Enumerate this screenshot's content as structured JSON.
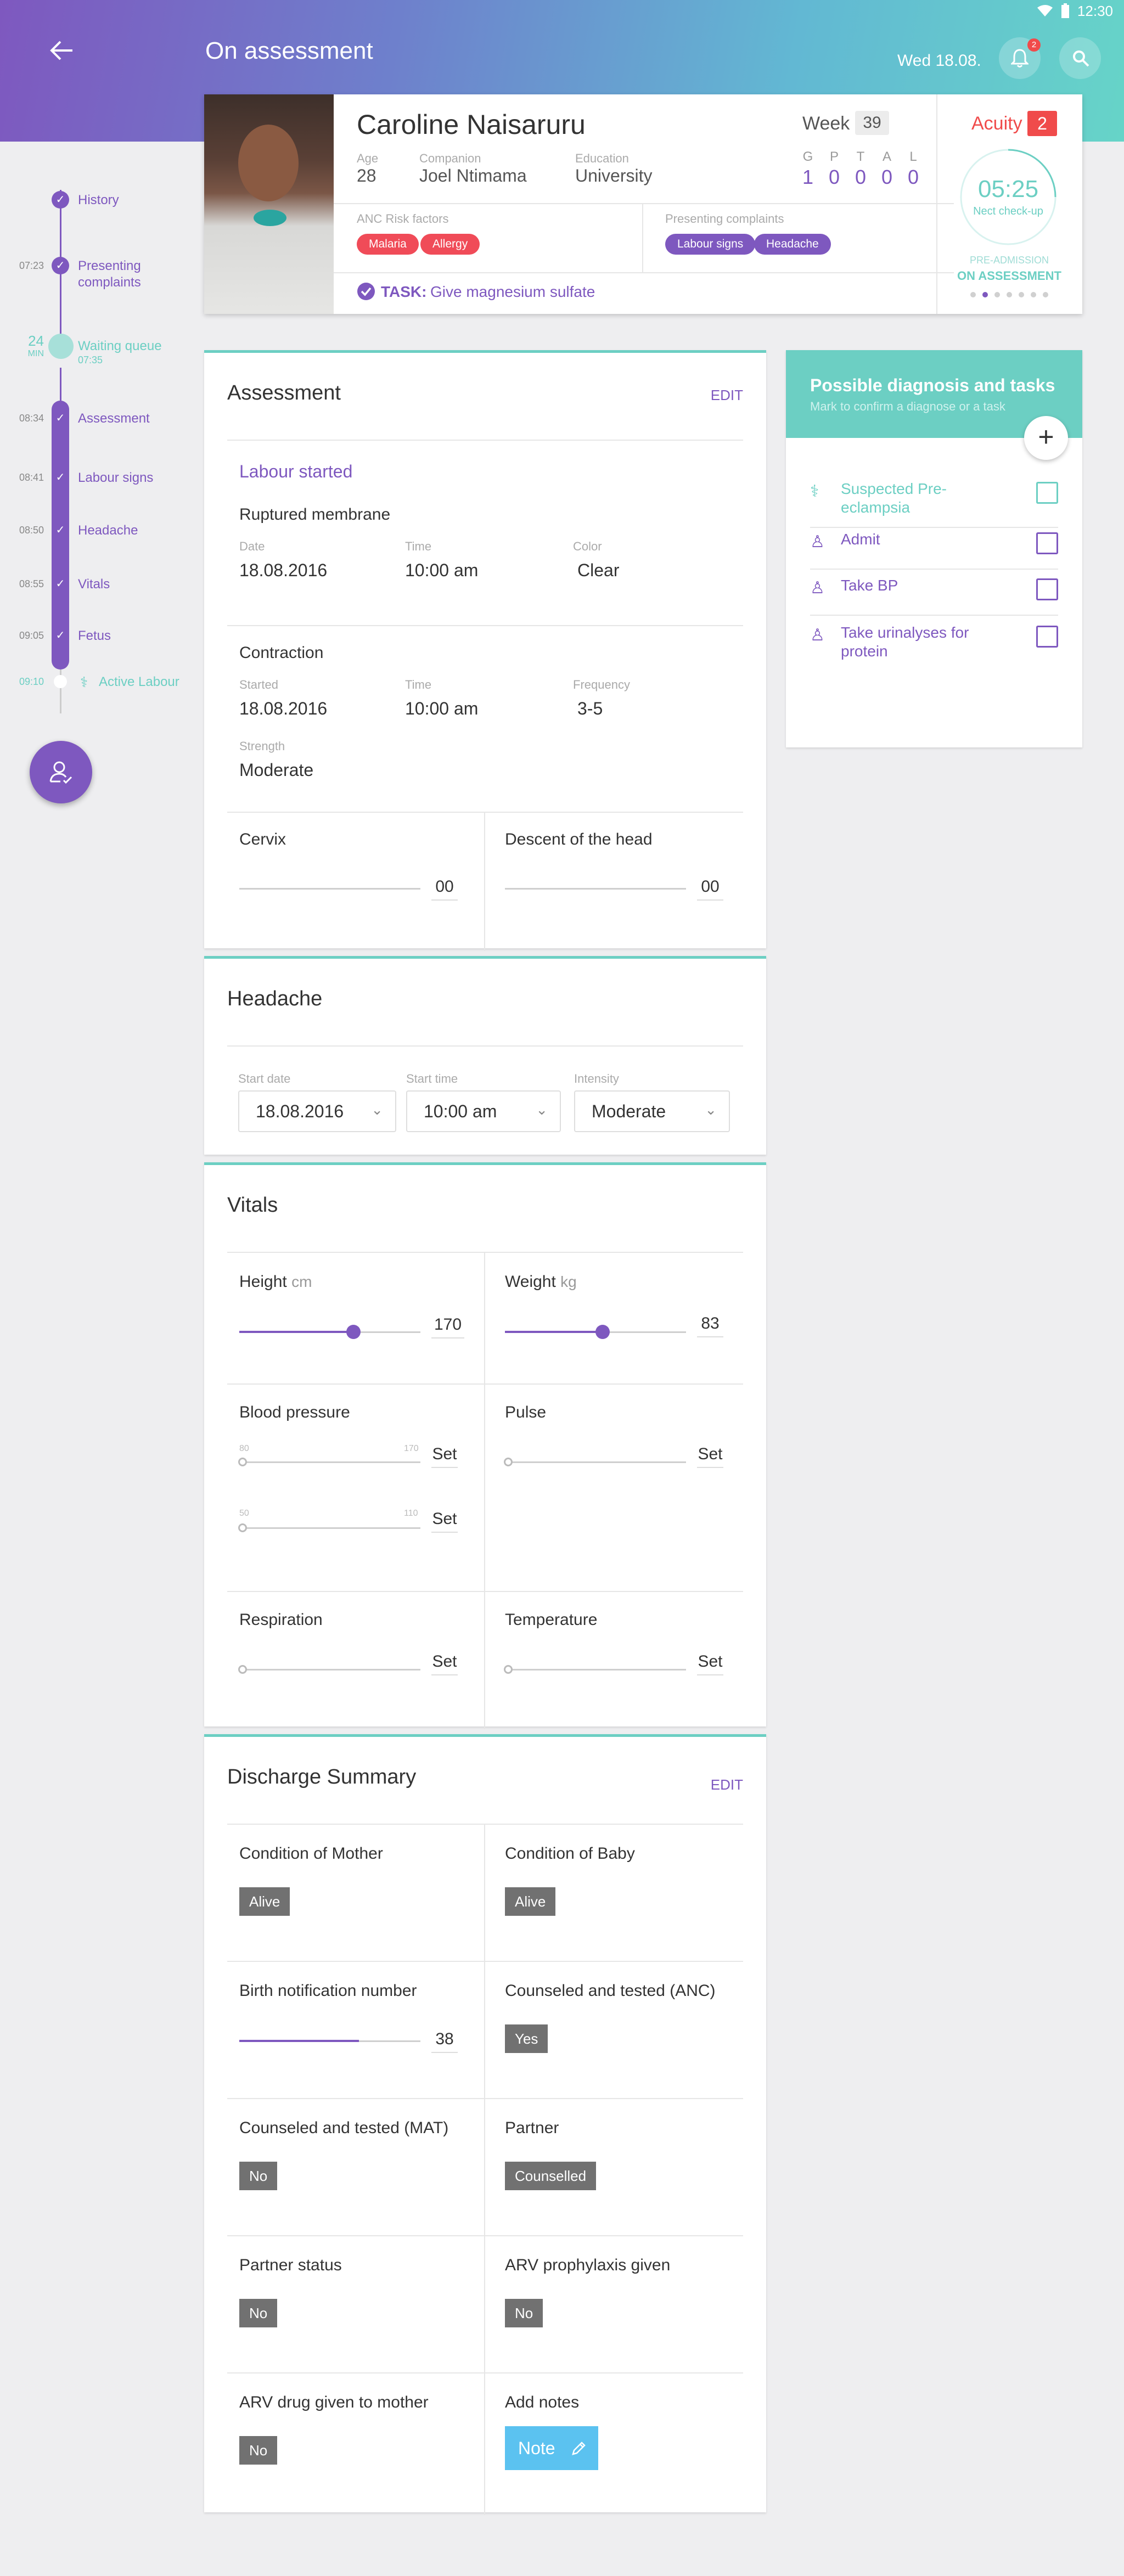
{
  "status_bar": {
    "time": "12:30"
  },
  "header": {
    "title": "On assessment",
    "date": "Wed 18.08.",
    "notification_count": "2"
  },
  "patient": {
    "name": "Caroline Naisaruru",
    "age_label": "Age",
    "age": "28",
    "companion_label": "Companion",
    "companion": "Joel Ntimama",
    "education_label": "Education",
    "education": "University",
    "week_label": "Week",
    "week": "39",
    "gptal_letters": [
      "G",
      "P",
      "T",
      "A",
      "L"
    ],
    "gptal_values": [
      "1",
      "0",
      "0",
      "0",
      "0"
    ],
    "risk_label": "ANC Risk factors",
    "risk_factors": [
      "Malaria",
      "Allergy"
    ],
    "complaints_label": "Presenting complaints",
    "complaints": [
      "Labour signs",
      "Headache"
    ],
    "task_label": "TASK:",
    "task_text": "Give magnesium sulfate"
  },
  "acuity": {
    "label": "Acuity",
    "value": "2",
    "timer": "05:25",
    "timer_sub": "Nect check-up",
    "pre_admission": "PRE-ADMISSION",
    "on_assessment": "ON ASSESSMENT",
    "dots_active": 1,
    "dots_total": 7
  },
  "timeline": [
    {
      "label": "History",
      "time": ""
    },
    {
      "label": "Presenting complaints",
      "time": "07:23"
    },
    {
      "label": "Waiting queue",
      "time": "24",
      "unit": "MIN",
      "sub": "07:35"
    },
    {
      "label": "Assessment",
      "time": "08:34"
    },
    {
      "label": "Labour signs",
      "time": "08:41"
    },
    {
      "label": "Headache",
      "time": "08:50"
    },
    {
      "label": "Vitals",
      "time": "08:55"
    },
    {
      "label": "Fetus",
      "time": "09:05"
    },
    {
      "label": "Active Labour",
      "time": "09:10"
    }
  ],
  "assessment": {
    "title": "Assessment",
    "edit": "EDIT",
    "labour_started": "Labour started",
    "ruptured_title": "Ruptured membrane",
    "ruptured": [
      {
        "label": "Date",
        "value": "18.08.2016"
      },
      {
        "label": "Time",
        "value": "10:00 am"
      },
      {
        "label": "Color",
        "value": "Clear"
      }
    ],
    "contraction_title": "Contraction",
    "contraction": [
      {
        "label": "Started",
        "value": "18.08.2016"
      },
      {
        "label": "Time",
        "value": "10:00 am"
      },
      {
        "label": "Frequency",
        "value": "3-5"
      }
    ],
    "strength_label": "Strength",
    "strength": "Moderate",
    "cervix_title": "Cervix",
    "cervix_value": "00",
    "descent_title": "Descent of the head",
    "descent_value": "00"
  },
  "headache": {
    "title": "Headache",
    "start_date_label": "Start date",
    "start_date": "18.08.2016",
    "start_time_label": "Start time",
    "start_time": "10:00 am",
    "intensity_label": "Intensity",
    "intensity": "Moderate"
  },
  "vitals": {
    "title": "Vitals",
    "height_label": "Height",
    "height_unit": "cm",
    "height": "170",
    "height_level": 0.63,
    "weight_label": "Weight",
    "weight_unit": "kg",
    "weight": "83",
    "weight_level": 0.54,
    "bp_label": "Blood pressure",
    "bp_sys_min": "80",
    "bp_sys_max": "170",
    "bp_dia_min": "50",
    "bp_dia_max": "110",
    "pulse_label": "Pulse",
    "respiration_label": "Respiration",
    "temperature_label": "Temperature",
    "set": "Set"
  },
  "discharge": {
    "title": "Discharge Summary",
    "edit": "EDIT",
    "mother_label": "Condition of Mother",
    "mother": "Alive",
    "baby_label": "Condition of Baby",
    "baby": "Alive",
    "birth_label": "Birth notification number",
    "birth": "38",
    "birth_level": 0.66,
    "anc_label": "Counseled and tested (ANC)",
    "anc": "Yes",
    "mat_label": "Counseled and tested (MAT)",
    "mat": "No",
    "partner_label": "Partner",
    "partner": "Counselled",
    "partner_status_label": "Partner status",
    "partner_status": "No",
    "arv_proph_label": "ARV prophylaxis given",
    "arv_proph": "No",
    "arv_drug_label": "ARV drug given to mother",
    "arv_drug": "No",
    "notes_label": "Add notes",
    "note_button": "Note"
  },
  "diagnosis": {
    "title": "Possible diagnosis and tasks",
    "subtitle": "Mark to confirm a diagnose or a task",
    "items": [
      {
        "label": "Suspected Pre-eclampsia",
        "icon": "stethoscope-icon"
      },
      {
        "label": "Admit",
        "icon": "person-check-icon"
      },
      {
        "label": "Take BP",
        "icon": "person-check-icon"
      },
      {
        "label": "Take urinalyses for protein",
        "icon": "person-check-icon"
      }
    ]
  }
}
